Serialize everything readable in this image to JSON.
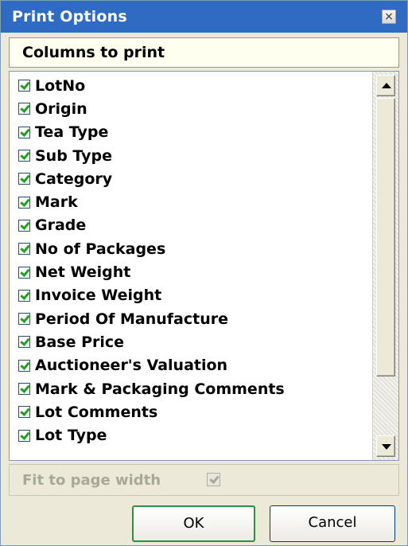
{
  "dialog": {
    "title": "Print Options",
    "close_glyph": "×"
  },
  "columns_section": {
    "header": "Columns to print",
    "items": [
      {
        "label": "LotNo",
        "checked": true
      },
      {
        "label": "Origin",
        "checked": true
      },
      {
        "label": "Tea Type",
        "checked": true
      },
      {
        "label": "Sub Type",
        "checked": true
      },
      {
        "label": "Category",
        "checked": true
      },
      {
        "label": "Mark",
        "checked": true
      },
      {
        "label": "Grade",
        "checked": true
      },
      {
        "label": "No of Packages",
        "checked": true
      },
      {
        "label": "Net Weight",
        "checked": true
      },
      {
        "label": "Invoice Weight",
        "checked": true
      },
      {
        "label": "Period Of Manufacture",
        "checked": true
      },
      {
        "label": "Base Price",
        "checked": true
      },
      {
        "label": "Auctioneer's Valuation",
        "checked": true
      },
      {
        "label": "Mark & Packaging Comments",
        "checked": true
      },
      {
        "label": "Lot Comments",
        "checked": true
      },
      {
        "label": "Lot Type",
        "checked": true
      }
    ]
  },
  "fit_to_page": {
    "label": "Fit to page width",
    "checked": true,
    "enabled": false
  },
  "buttons": {
    "ok": "OK",
    "cancel": "Cancel"
  },
  "colors": {
    "titlebar": "#2f6bc2",
    "header_bg": "#ffffef",
    "dialog_bg": "#ece9d8",
    "check_mark": "#21a121",
    "ok_border": "#2f8f3f"
  }
}
